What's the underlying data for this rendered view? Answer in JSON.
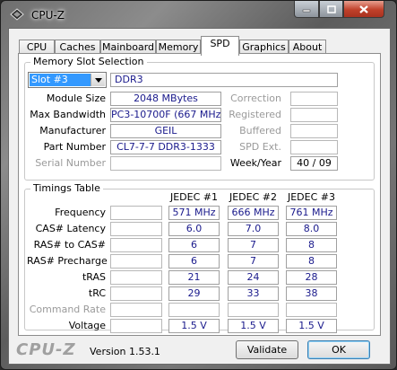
{
  "window": {
    "title": "CPU-Z"
  },
  "tabs": [
    "CPU",
    "Caches",
    "Mainboard",
    "Memory",
    "SPD",
    "Graphics",
    "About"
  ],
  "active_tab": "SPD",
  "slot_section": {
    "title": "Memory Slot Selection",
    "slot_selected": "Slot #3",
    "memory_type": "DDR3",
    "module_size_label": "Module Size",
    "module_size": "2048 MBytes",
    "max_bandwidth_label": "Max Bandwidth",
    "max_bandwidth": "PC3-10700F (667 MHz)",
    "manufacturer_label": "Manufacturer",
    "manufacturer": "GEIL",
    "part_number_label": "Part Number",
    "part_number": "CL7-7-7 DDR3-1333",
    "serial_number_label": "Serial Number",
    "serial_number": "",
    "correction_label": "Correction",
    "correction": "",
    "registered_label": "Registered",
    "registered": "",
    "buffered_label": "Buffered",
    "buffered": "",
    "spd_ext_label": "SPD Ext.",
    "spd_ext": "",
    "week_year_label": "Week/Year",
    "week_year": "40 / 09"
  },
  "timings": {
    "title": "Timings Table",
    "columns": [
      "JEDEC #1",
      "JEDEC #2",
      "JEDEC #3"
    ],
    "rows": [
      {
        "label": "Frequency",
        "values": [
          "571 MHz",
          "666 MHz",
          "761 MHz"
        ]
      },
      {
        "label": "CAS# Latency",
        "values": [
          "6.0",
          "7.0",
          "8.0"
        ]
      },
      {
        "label": "RAS# to CAS#",
        "values": [
          "6",
          "7",
          "8"
        ]
      },
      {
        "label": "RAS# Precharge",
        "values": [
          "6",
          "7",
          "8"
        ]
      },
      {
        "label": "tRAS",
        "values": [
          "21",
          "24",
          "28"
        ]
      },
      {
        "label": "tRC",
        "values": [
          "29",
          "33",
          "38"
        ]
      },
      {
        "label": "Command Rate",
        "values": [
          "",
          "",
          ""
        ]
      },
      {
        "label": "Voltage",
        "values": [
          "1.5 V",
          "1.5 V",
          "1.5 V"
        ]
      }
    ]
  },
  "footer": {
    "logo": "CPU-Z",
    "version": "Version 1.53.1",
    "validate_label": "Validate",
    "ok_label": "OK"
  }
}
